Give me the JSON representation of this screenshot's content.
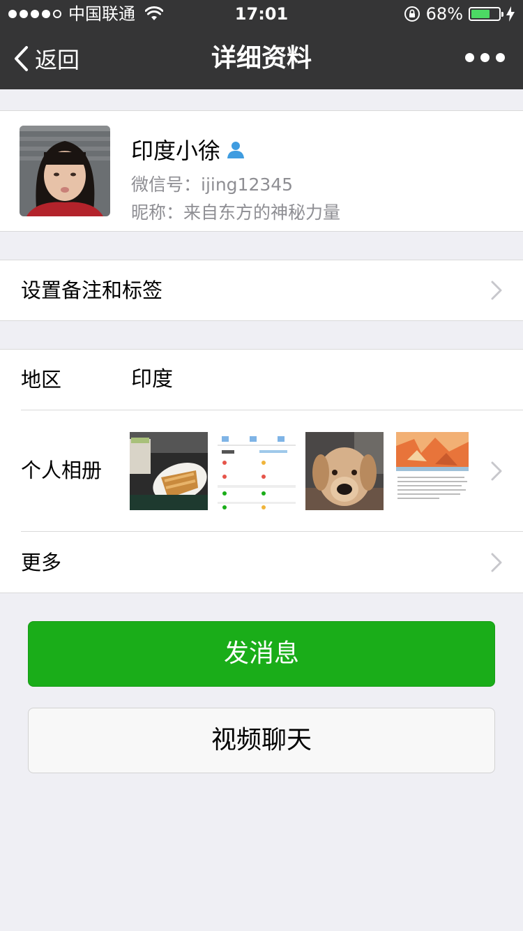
{
  "status_bar": {
    "carrier": "中国联通",
    "time": "17:01",
    "battery_percent": "68%",
    "battery_level": 0.68,
    "battery_color": "#4cd964"
  },
  "nav": {
    "back_label": "返回",
    "title": "详细资料",
    "more_icon": "more-dots-icon"
  },
  "profile": {
    "name": "印度小徐",
    "wechat_id": "微信号：ijing12345",
    "nickname": "昵称：来自东方的神秘力量"
  },
  "remark_row": {
    "label": "设置备注和标签"
  },
  "region_row": {
    "label": "地区",
    "value": "印度"
  },
  "album_row": {
    "label": "个人相册",
    "thumbnails": [
      "food-photo",
      "app-screenshot",
      "dog-photo",
      "article-screenshot"
    ]
  },
  "more_row": {
    "label": "更多"
  },
  "buttons": {
    "send_message": "发消息",
    "video_chat": "视频聊天"
  },
  "colors": {
    "nav_bg": "#353536",
    "primary_green": "#1aad19",
    "page_bg": "#efeff4"
  }
}
